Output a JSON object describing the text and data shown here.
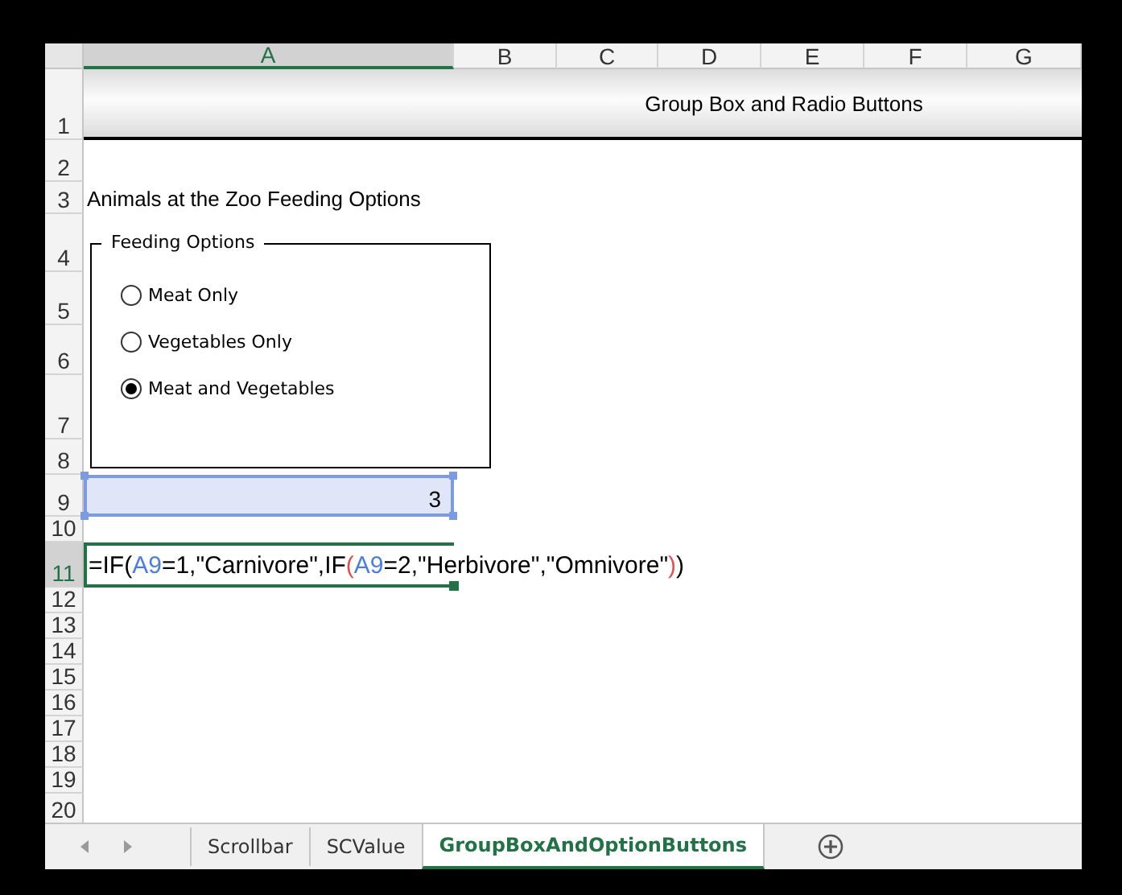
{
  "columns": [
    {
      "label": "A",
      "selected": true
    },
    {
      "label": "B",
      "selected": false
    },
    {
      "label": "C",
      "selected": false
    },
    {
      "label": "D",
      "selected": false
    },
    {
      "label": "E",
      "selected": false
    },
    {
      "label": "F",
      "selected": false
    },
    {
      "label": "G",
      "selected": false
    }
  ],
  "rows": [
    {
      "label": "1",
      "selected": false
    },
    {
      "label": "2",
      "selected": false
    },
    {
      "label": "3",
      "selected": false
    },
    {
      "label": "4",
      "selected": false
    },
    {
      "label": "5",
      "selected": false
    },
    {
      "label": "6",
      "selected": false
    },
    {
      "label": "7",
      "selected": false
    },
    {
      "label": "8",
      "selected": false
    },
    {
      "label": "9",
      "selected": false
    },
    {
      "label": "10",
      "selected": false
    },
    {
      "label": "11",
      "selected": true
    },
    {
      "label": "12",
      "selected": false
    },
    {
      "label": "13",
      "selected": false
    },
    {
      "label": "14",
      "selected": false
    },
    {
      "label": "15",
      "selected": false
    },
    {
      "label": "16",
      "selected": false
    },
    {
      "label": "17",
      "selected": false
    },
    {
      "label": "18",
      "selected": false
    },
    {
      "label": "19",
      "selected": false
    },
    {
      "label": "20",
      "selected": false
    }
  ],
  "title": "Group Box and Radio Buttons",
  "heading": "Animals at the Zoo Feeding Options",
  "group_box": {
    "label": "Feeding Options",
    "options": [
      {
        "label": "Meat Only",
        "selected": false
      },
      {
        "label": "Vegetables Only",
        "selected": false
      },
      {
        "label": "Meat and Vegetables",
        "selected": true
      }
    ]
  },
  "linked_cell": {
    "value": "3"
  },
  "formula": {
    "tokens": [
      {
        "text": "=IF(",
        "kind": "text"
      },
      {
        "text": "A9",
        "kind": "ref"
      },
      {
        "text": "=1,\"Carnivore\",IF",
        "kind": "text"
      },
      {
        "text": "(",
        "kind": "paren"
      },
      {
        "text": "A9",
        "kind": "ref"
      },
      {
        "text": "=2,\"Herbivore\",\"Omnivore\"",
        "kind": "text"
      },
      {
        "text": ")",
        "kind": "paren"
      },
      {
        "text": ")",
        "kind": "text"
      }
    ]
  },
  "tabs": [
    {
      "label": "Scrollbar",
      "selected": false
    },
    {
      "label": "SCValue",
      "selected": false
    },
    {
      "label": "GroupBoxAndOptionButtons",
      "selected": true
    }
  ]
}
